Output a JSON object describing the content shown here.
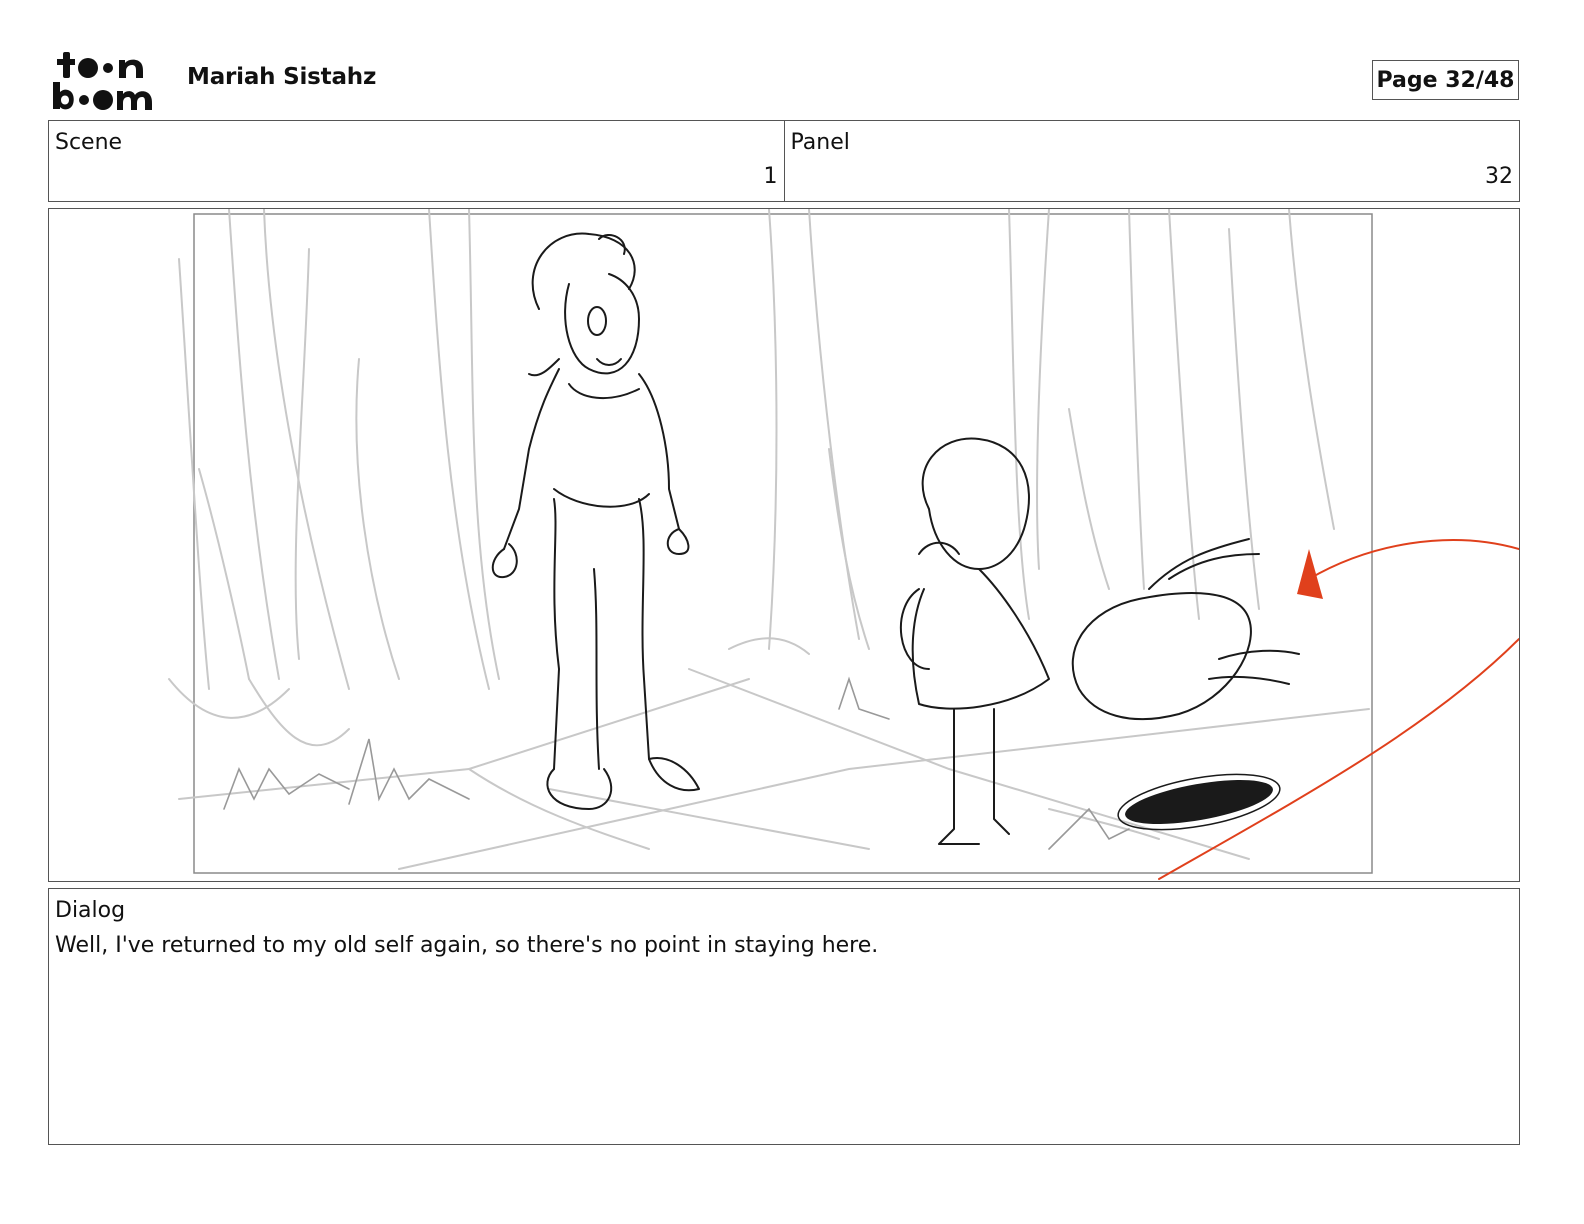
{
  "header": {
    "logo_text": "toonboom",
    "project_title": "Mariah Sistahz",
    "page_indicator": "Page 32/48"
  },
  "info": {
    "scene_label": "Scene",
    "scene_value": "1",
    "panel_label": "Panel",
    "panel_value": "32"
  },
  "dialog": {
    "label": "Dialog",
    "text": "Well, I've returned to my old self again, so there's no point in staying here."
  },
  "colors": {
    "sketch_line": "#1a1a1a",
    "background_sketch": "#c8c8c8",
    "motion_path": "#e0401c"
  }
}
